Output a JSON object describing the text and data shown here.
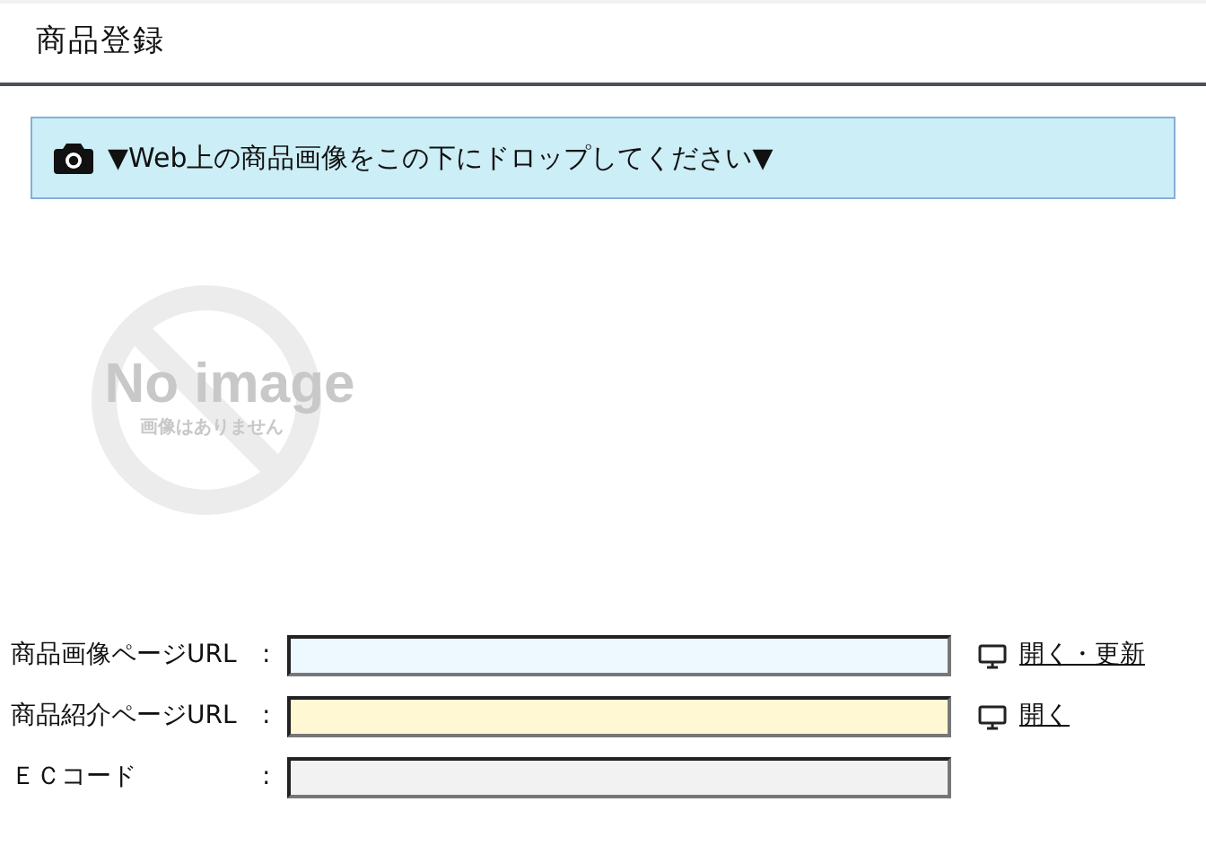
{
  "header": {
    "title": "商品登録"
  },
  "drop_zone": {
    "text": "▼Web上の商品画像をこの下にドロップしてください▼"
  },
  "placeholder_image": {
    "title": "No image",
    "subtitle": "画像はありません"
  },
  "fields": [
    {
      "label": "商品画像ページURL",
      "colon": ":",
      "color": "#eef8ff",
      "link": "開く・更新"
    },
    {
      "label": "商品紹介ページURL",
      "colon": ":",
      "color": "#fff8d2",
      "link": "開く"
    },
    {
      "label": "ＥＣコード",
      "colon": ":",
      "color": "#f2f2f2"
    }
  ]
}
